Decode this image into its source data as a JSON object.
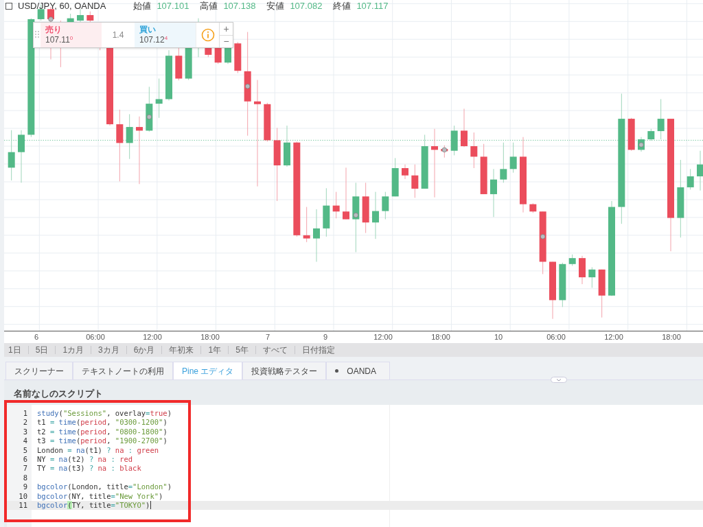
{
  "header": {
    "symbol": "USD/JPY, 60, OANDA",
    "ohlc": [
      {
        "label": "始値",
        "value": "107.101"
      },
      {
        "label": "高値",
        "value": "107.138"
      },
      {
        "label": "安値",
        "value": "107.082"
      },
      {
        "label": "終値",
        "value": "107.117"
      }
    ]
  },
  "trade_panel": {
    "sell": {
      "label": "売り",
      "price": "107.11$^{0}$"
    },
    "spread": "1.4",
    "buy": {
      "label": "買い",
      "price": "107.12$^{4}$"
    },
    "zoom_buttons": [
      "+",
      "−"
    ]
  },
  "time_axis": [
    "6",
    "06:00",
    "12:00",
    "18:00",
    "7",
    "9",
    "12:00",
    "18:00",
    "10",
    "06:00",
    "12:00",
    "18:00"
  ],
  "ranges": [
    "1日",
    "5日",
    "1カ月",
    "3カ月",
    "6か月",
    "年初来",
    "1年",
    "5年",
    "すべて",
    "日付指定"
  ],
  "tabs": [
    {
      "label": "スクリーナー",
      "selected": false,
      "dot": false
    },
    {
      "label": "テキストノートの利用",
      "selected": false,
      "dot": false
    },
    {
      "label": "Pine エディタ",
      "selected": true,
      "dot": false
    },
    {
      "label": "投資戦略テスター",
      "selected": false,
      "dot": false
    },
    {
      "label": "OANDA",
      "selected": false,
      "dot": true
    }
  ],
  "editor": {
    "title": "名前なしのスクリプト",
    "lines": [
      {
        "number": "1",
        "current": false,
        "tokens": [
          {
            "text": "study",
            "kind": "fn"
          },
          {
            "text": "(",
            "kind": "plain"
          },
          {
            "text": "\"Sessions\"",
            "kind": "str"
          },
          {
            "text": ", overlay",
            "kind": "plain"
          },
          {
            "text": "=",
            "kind": "op"
          },
          {
            "text": "true",
            "kind": "kw"
          },
          {
            "text": ")",
            "kind": "plain"
          }
        ]
      },
      {
        "number": "2",
        "current": false,
        "tokens": [
          {
            "text": "t1 ",
            "kind": "plain"
          },
          {
            "text": "=",
            "kind": "op"
          },
          {
            "text": " time",
            "kind": "fn"
          },
          {
            "text": "(",
            "kind": "plain"
          },
          {
            "text": "period",
            "kind": "kw"
          },
          {
            "text": ", ",
            "kind": "plain"
          },
          {
            "text": "\"0300-1200\"",
            "kind": "str"
          },
          {
            "text": ")",
            "kind": "plain"
          }
        ]
      },
      {
        "number": "3",
        "current": false,
        "tokens": [
          {
            "text": "t2 ",
            "kind": "plain"
          },
          {
            "text": "=",
            "kind": "op"
          },
          {
            "text": " time",
            "kind": "fn"
          },
          {
            "text": "(",
            "kind": "plain"
          },
          {
            "text": "period",
            "kind": "kw"
          },
          {
            "text": ", ",
            "kind": "plain"
          },
          {
            "text": "\"0800-1800\"",
            "kind": "str"
          },
          {
            "text": ")",
            "kind": "plain"
          }
        ]
      },
      {
        "number": "4",
        "current": false,
        "tokens": [
          {
            "text": "t3 ",
            "kind": "plain"
          },
          {
            "text": "=",
            "kind": "op"
          },
          {
            "text": " time",
            "kind": "fn"
          },
          {
            "text": "(",
            "kind": "plain"
          },
          {
            "text": "period",
            "kind": "kw"
          },
          {
            "text": ", ",
            "kind": "plain"
          },
          {
            "text": "\"1900-2700\"",
            "kind": "str"
          },
          {
            "text": ")",
            "kind": "plain"
          }
        ]
      },
      {
        "number": "5",
        "current": false,
        "tokens": [
          {
            "text": "London ",
            "kind": "plain"
          },
          {
            "text": "=",
            "kind": "op"
          },
          {
            "text": " na",
            "kind": "fn"
          },
          {
            "text": "(t1) ",
            "kind": "plain"
          },
          {
            "text": "?",
            "kind": "op"
          },
          {
            "text": " na ",
            "kind": "kw"
          },
          {
            "text": ":",
            "kind": "op"
          },
          {
            "text": " green",
            "kind": "kw"
          }
        ]
      },
      {
        "number": "6",
        "current": false,
        "tokens": [
          {
            "text": "NY ",
            "kind": "plain"
          },
          {
            "text": "=",
            "kind": "op"
          },
          {
            "text": " na",
            "kind": "fn"
          },
          {
            "text": "(t2) ",
            "kind": "plain"
          },
          {
            "text": "?",
            "kind": "op"
          },
          {
            "text": " na ",
            "kind": "kw"
          },
          {
            "text": ":",
            "kind": "op"
          },
          {
            "text": " red",
            "kind": "kw"
          }
        ]
      },
      {
        "number": "7",
        "current": false,
        "tokens": [
          {
            "text": "TY ",
            "kind": "plain"
          },
          {
            "text": "=",
            "kind": "op"
          },
          {
            "text": " na",
            "kind": "fn"
          },
          {
            "text": "(t3) ",
            "kind": "plain"
          },
          {
            "text": "?",
            "kind": "op"
          },
          {
            "text": " na ",
            "kind": "kw"
          },
          {
            "text": ":",
            "kind": "op"
          },
          {
            "text": " black",
            "kind": "kw"
          }
        ]
      },
      {
        "number": "8",
        "current": false
      },
      {
        "number": "9",
        "current": false,
        "tokens": [
          {
            "text": "bgcolor",
            "kind": "fn"
          },
          {
            "text": "(London, title",
            "kind": "plain"
          },
          {
            "text": "=",
            "kind": "op"
          },
          {
            "text": "\"London\"",
            "kind": "str"
          },
          {
            "text": ")",
            "kind": "plain"
          }
        ]
      },
      {
        "number": "10",
        "current": false,
        "tokens": [
          {
            "text": "bgcolor",
            "kind": "fn"
          },
          {
            "text": "(NY, title",
            "kind": "plain"
          },
          {
            "text": "=",
            "kind": "op"
          },
          {
            "text": "\"New York\"",
            "kind": "str"
          },
          {
            "text": ")",
            "kind": "plain"
          }
        ]
      },
      {
        "number": "11",
        "current": true,
        "tokens": [
          {
            "text": "bgcolor",
            "kind": "fn"
          },
          {
            "text": "(",
            "kind": "match"
          },
          {
            "text": "TY, title",
            "kind": "plain"
          },
          {
            "text": "=",
            "kind": "op"
          },
          {
            "text": "\"TOKYO\"",
            "kind": "str"
          },
          {
            "text": ")",
            "kind": "plain"
          }
        ]
      }
    ]
  }
}
